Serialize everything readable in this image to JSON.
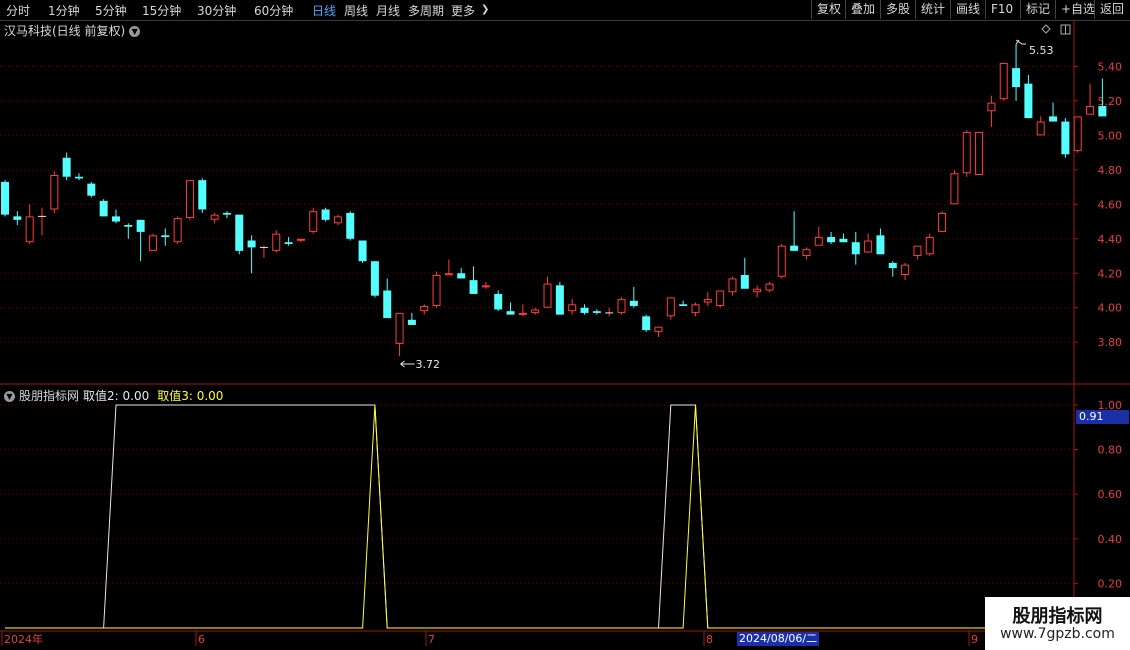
{
  "toolbar": {
    "periods": [
      "分时",
      "1分钟",
      "5分钟",
      "15分钟",
      "30分钟",
      "60分钟",
      "日线",
      "周线",
      "月线",
      "多周期",
      "更多"
    ],
    "more_arrow": "❯",
    "active_period": "日线",
    "tools": [
      "复权",
      "叠加",
      "多股",
      "统计",
      "画线",
      "F10",
      "标记",
      "+自选",
      "返回"
    ]
  },
  "stock": {
    "title": "汉马科技(日线 前复权)",
    "dropdown_icon": "chevron-down-icon"
  },
  "indicator": {
    "name": "股朋指标网",
    "value2_label": "取值2: 0.00",
    "value3_label": "取值3: 0.00",
    "current_value": "0.91"
  },
  "axis": {
    "price_ticks": [
      "5.40",
      "5.20",
      "5.00",
      "4.80",
      "4.60",
      "4.40",
      "4.20",
      "4.00",
      "3.80"
    ],
    "indicator_ticks": [
      "1.00",
      "0.80",
      "0.60",
      "0.40",
      "0.20"
    ],
    "date_labels": [
      "2024年",
      "6",
      "7",
      "8",
      "9"
    ],
    "crosshair_date": "2024/08/06/二"
  },
  "annotations": {
    "high": "5.53",
    "low": "3.72"
  },
  "watermark": {
    "line1": "股朋指标网",
    "line2": "www.7gpzb.com"
  },
  "colors": {
    "up": "#ff3c3c",
    "down": "#54ffff",
    "value2_line": "#e8e8e8",
    "value3_line": "#ffff3c",
    "grid": "#5a0000",
    "frame": "#a01818"
  },
  "chart_data": [
    {
      "type": "candlestick",
      "title": "汉马科技(日线 前复权)",
      "ylim": [
        3.72,
        5.53
      ],
      "ohlc": [
        [
          4.73,
          4.74,
          4.53,
          4.54
        ],
        [
          4.53,
          4.56,
          4.48,
          4.51
        ],
        [
          4.38,
          4.6,
          4.37,
          4.53
        ],
        [
          4.53,
          4.58,
          4.42,
          4.53
        ],
        [
          4.57,
          4.79,
          4.55,
          4.77
        ],
        [
          4.87,
          4.9,
          4.74,
          4.76
        ],
        [
          4.76,
          4.78,
          4.74,
          4.75
        ],
        [
          4.72,
          4.73,
          4.64,
          4.65
        ],
        [
          4.62,
          4.63,
          4.53,
          4.53
        ],
        [
          4.53,
          4.57,
          4.49,
          4.5
        ],
        [
          4.48,
          4.49,
          4.4,
          4.47
        ],
        [
          4.51,
          4.51,
          4.27,
          4.44
        ],
        [
          4.33,
          4.43,
          4.33,
          4.42
        ],
        [
          4.42,
          4.46,
          4.36,
          4.41
        ],
        [
          4.38,
          4.53,
          4.37,
          4.52
        ],
        [
          4.52,
          4.74,
          4.51,
          4.74
        ],
        [
          4.74,
          4.75,
          4.55,
          4.57
        ],
        [
          4.51,
          4.55,
          4.49,
          4.54
        ],
        [
          4.55,
          4.56,
          4.52,
          4.54
        ],
        [
          4.54,
          4.54,
          4.31,
          4.33
        ],
        [
          4.39,
          4.42,
          4.2,
          4.35
        ],
        [
          4.35,
          4.36,
          4.29,
          4.35
        ],
        [
          4.33,
          4.45,
          4.32,
          4.43
        ],
        [
          4.38,
          4.41,
          4.36,
          4.37
        ],
        [
          4.39,
          4.4,
          4.38,
          4.4
        ],
        [
          4.44,
          4.58,
          4.43,
          4.56
        ],
        [
          4.57,
          4.58,
          4.5,
          4.51
        ],
        [
          4.49,
          4.54,
          4.48,
          4.53
        ],
        [
          4.55,
          4.56,
          4.39,
          4.4
        ],
        [
          4.39,
          4.39,
          4.26,
          4.27
        ],
        [
          4.27,
          4.27,
          4.06,
          4.07
        ],
        [
          4.1,
          4.17,
          3.95,
          3.94
        ],
        [
          3.79,
          3.97,
          3.72,
          3.97
        ],
        [
          3.93,
          3.97,
          3.9,
          3.9
        ],
        [
          3.98,
          4.02,
          3.96,
          4.01
        ],
        [
          4.01,
          4.21,
          4.0,
          4.19
        ],
        [
          4.19,
          4.28,
          4.19,
          4.2
        ],
        [
          4.2,
          4.23,
          4.17,
          4.17
        ],
        [
          4.16,
          4.24,
          4.09,
          4.08
        ],
        [
          4.12,
          4.15,
          4.11,
          4.13
        ],
        [
          4.08,
          4.1,
          3.98,
          3.99
        ],
        [
          3.98,
          4.03,
          3.96,
          3.96
        ],
        [
          3.96,
          4.02,
          3.95,
          3.97
        ],
        [
          3.97,
          4.0,
          3.96,
          3.99
        ],
        [
          4.0,
          4.18,
          4.0,
          4.14
        ],
        [
          4.13,
          4.15,
          3.97,
          3.96
        ],
        [
          3.98,
          4.05,
          3.96,
          4.02
        ],
        [
          4.0,
          4.02,
          3.96,
          3.97
        ],
        [
          3.98,
          3.99,
          3.96,
          3.97
        ],
        [
          3.97,
          4.0,
          3.95,
          3.97
        ],
        [
          3.97,
          4.06,
          3.96,
          4.05
        ],
        [
          4.04,
          4.12,
          4.0,
          4.01
        ],
        [
          3.95,
          3.96,
          3.86,
          3.87
        ],
        [
          3.86,
          3.89,
          3.83,
          3.89
        ],
        [
          3.95,
          4.06,
          3.93,
          4.06
        ],
        [
          4.02,
          4.04,
          4.01,
          4.01
        ],
        [
          3.97,
          4.03,
          3.95,
          4.02
        ],
        [
          4.03,
          4.09,
          4.01,
          4.05
        ],
        [
          4.01,
          4.09,
          4.0,
          4.1
        ],
        [
          4.09,
          4.18,
          4.07,
          4.17
        ],
        [
          4.19,
          4.29,
          4.14,
          4.11
        ],
        [
          4.09,
          4.13,
          4.06,
          4.11
        ],
        [
          4.1,
          4.15,
          4.09,
          4.14
        ],
        [
          4.18,
          4.37,
          4.17,
          4.36
        ],
        [
          4.36,
          4.56,
          4.33,
          4.33
        ],
        [
          4.3,
          4.35,
          4.28,
          4.34
        ],
        [
          4.36,
          4.47,
          4.37,
          4.41
        ],
        [
          4.41,
          4.44,
          4.37,
          4.38
        ],
        [
          4.4,
          4.43,
          4.39,
          4.38
        ],
        [
          4.38,
          4.44,
          4.25,
          4.31
        ],
        [
          4.32,
          4.43,
          4.32,
          4.39
        ],
        [
          4.42,
          4.46,
          4.32,
          4.31
        ],
        [
          4.26,
          4.27,
          4.18,
          4.23
        ],
        [
          4.19,
          4.26,
          4.16,
          4.25
        ],
        [
          4.3,
          4.35,
          4.28,
          4.36
        ],
        [
          4.31,
          4.43,
          4.3,
          4.41
        ],
        [
          4.44,
          4.56,
          4.44,
          4.55
        ],
        [
          4.6,
          4.8,
          4.6,
          4.78
        ],
        [
          4.78,
          5.03,
          4.76,
          5.02
        ],
        [
          4.77,
          5.02,
          4.77,
          5.02
        ],
        [
          5.14,
          5.23,
          5.05,
          5.19
        ],
        [
          5.21,
          5.42,
          5.2,
          5.42
        ],
        [
          5.39,
          5.53,
          5.2,
          5.28
        ],
        [
          5.3,
          5.35,
          5.1,
          5.1
        ],
        [
          5.0,
          5.11,
          5.0,
          5.08
        ],
        [
          5.11,
          5.19,
          5.09,
          5.08
        ],
        [
          5.08,
          5.1,
          4.87,
          4.89
        ],
        [
          4.91,
          5.0,
          4.9,
          5.11
        ],
        [
          5.12,
          5.3,
          5.12,
          5.17
        ],
        [
          5.17,
          5.33,
          5.13,
          5.11
        ]
      ]
    },
    {
      "type": "line",
      "title": "股朋指标网",
      "ylim": [
        0,
        1
      ],
      "series": [
        {
          "name": "取值2",
          "values": [
            0,
            0,
            0,
            0,
            0,
            0,
            0,
            0,
            0,
            1,
            1,
            1,
            1,
            1,
            1,
            1,
            1,
            1,
            1,
            1,
            1,
            1,
            1,
            1,
            1,
            1,
            1,
            1,
            1,
            1,
            1,
            0,
            0,
            0,
            0,
            0,
            0,
            0,
            0,
            0,
            0,
            0,
            0,
            0,
            0,
            0,
            0,
            0,
            0,
            0,
            0,
            0,
            0,
            0,
            1,
            1,
            1,
            0,
            0,
            0,
            0,
            0,
            0,
            0,
            0,
            0,
            0,
            0,
            0,
            0,
            0,
            0,
            0,
            0,
            0,
            0,
            0,
            0,
            0,
            0,
            0,
            0,
            0,
            0,
            0,
            0,
            0,
            0,
            0,
            0
          ]
        },
        {
          "name": "取值3",
          "values": [
            0,
            0,
            0,
            0,
            0,
            0,
            0,
            0,
            0,
            0,
            0,
            0,
            0,
            0,
            0,
            0,
            0,
            0,
            0,
            0,
            0,
            0,
            0,
            0,
            0,
            0,
            0,
            0,
            0,
            0,
            1,
            0,
            0,
            0,
            0,
            0,
            0,
            0,
            0,
            0,
            0,
            0,
            0,
            0,
            0,
            0,
            0,
            0,
            0,
            0,
            0,
            0,
            0,
            0,
            0,
            0,
            1,
            0,
            0,
            0,
            0,
            0,
            0,
            0,
            0,
            0,
            0,
            0,
            0,
            0,
            0,
            0,
            0,
            0,
            0,
            0,
            0,
            0,
            0,
            0,
            0,
            0,
            0,
            0,
            0,
            0,
            0,
            0,
            0,
            0
          ]
        }
      ]
    }
  ]
}
